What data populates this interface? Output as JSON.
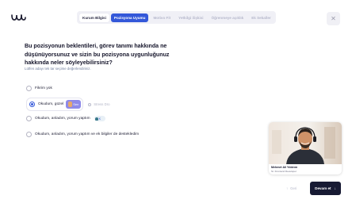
{
  "stepper": {
    "steps": [
      {
        "label": "Kurum Bilgisi",
        "state": "done"
      },
      {
        "label": "Pozisyona Uyumu",
        "state": "active"
      },
      {
        "label": "Motivo Fit",
        "state": "upcoming"
      },
      {
        "label": "Yetkilgi ilişkisi",
        "state": "upcoming"
      },
      {
        "label": "Öğrenmeye açıklık",
        "state": "upcoming"
      },
      {
        "label": "Ek Sekaller",
        "state": "upcoming"
      }
    ]
  },
  "close": {
    "icon": "close-icon"
  },
  "question": {
    "title": "Bu pozisyonun beklentileri, görev tanımı hakkında ne düşünüyorsunuz ve sizin bu pozisyona uygunluğunuz hakkında neler söyleyebilirsiniz?",
    "hint": "Lütfen adayı tek tar seçime değerlendiriniz."
  },
  "options": [
    {
      "label": "Fikrim yok",
      "selected": false
    },
    {
      "label": "Okudum, güzel",
      "selected": true,
      "chip_label": "Sen",
      "tag_label": "Stress Dro"
    },
    {
      "label": "Okudum, anladım, yorum yaptım",
      "selected": false,
      "icon_label": "K"
    },
    {
      "label": "Okudum, anladım, yorum yaptım ve ek bilgiler de destekledim",
      "selected": false
    }
  ],
  "candidate": {
    "name": "Mehmet Ali Yıldırım",
    "role": "Sr. Frontend Developer"
  },
  "nav": {
    "prev_label": "Geri",
    "next_label": "Devam et"
  },
  "colors": {
    "accent": "#3458d9",
    "primary_button": "#171a33",
    "chip": "#8f8ae8"
  }
}
